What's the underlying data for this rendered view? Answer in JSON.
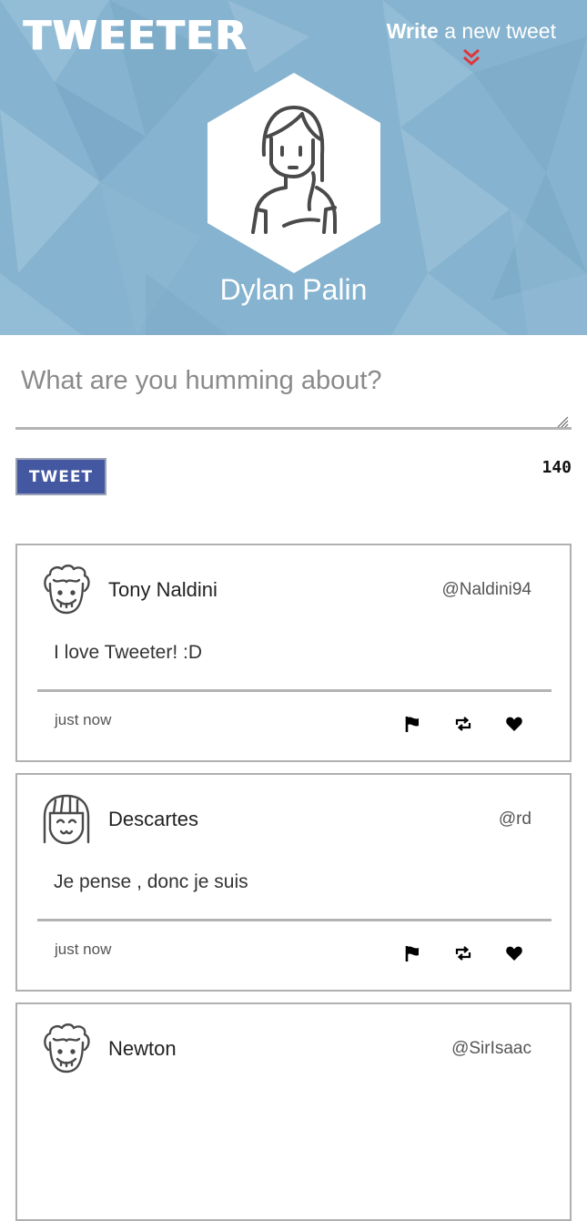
{
  "header": {
    "brand": "TWEETER",
    "compose_toggle": {
      "strong": "Write",
      "light": "a new tweet"
    },
    "profile_name": "Dylan Palin"
  },
  "composer": {
    "placeholder": "What are you humming about?",
    "button_label": "TWEET",
    "char_count": "140"
  },
  "tweets": [
    {
      "author": "Tony Naldini",
      "handle": "@Naldini94",
      "text": "I love Tweeter! :D",
      "time": "just now",
      "avatar_icon": "curly-hair-avatar-icon"
    },
    {
      "author": "Descartes",
      "handle": "@rd",
      "text": "Je pense , donc je suis",
      "time": "just now",
      "avatar_icon": "bob-hair-avatar-icon"
    },
    {
      "author": "Newton",
      "handle": "@SirIsaac",
      "text": "",
      "time": "",
      "avatar_icon": "curly-hair-avatar-icon"
    }
  ],
  "colors": {
    "header_bg": "#86b3cf",
    "button_bg": "#4458a2",
    "chevron": "#e0353b"
  }
}
